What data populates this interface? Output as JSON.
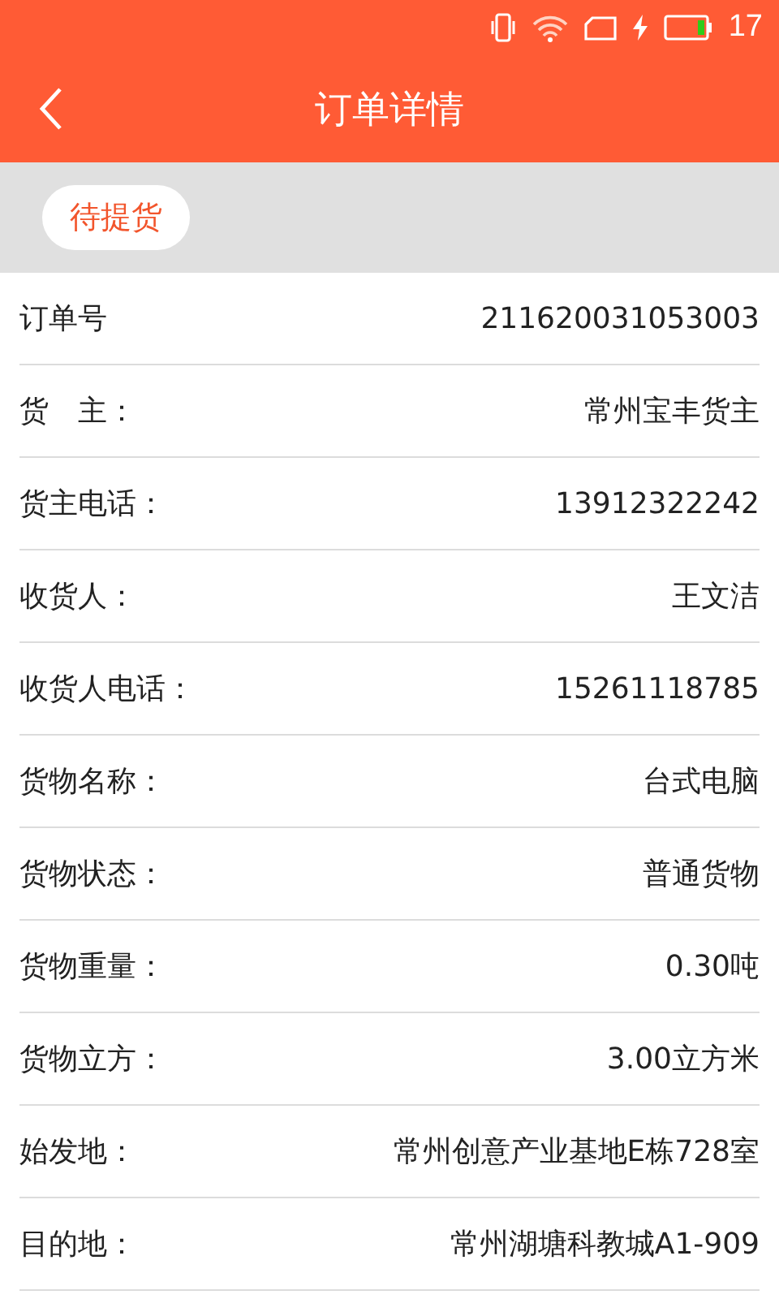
{
  "status_bar": {
    "time": "17"
  },
  "header": {
    "title": "订单详情"
  },
  "status_badge": "待提货",
  "fields": [
    {
      "label": "订单号",
      "value": "211620031053003"
    },
    {
      "label": "货　主：",
      "value": "常州宝丰货主"
    },
    {
      "label": "货主电话：",
      "value": "13912322242"
    },
    {
      "label": "收货人：",
      "value": "王文洁"
    },
    {
      "label": "收货人电话：",
      "value": "15261118785"
    },
    {
      "label": "货物名称：",
      "value": "台式电脑"
    },
    {
      "label": "货物状态：",
      "value": "普通货物"
    },
    {
      "label": "货物重量：",
      "value": "0.30吨"
    },
    {
      "label": "货物立方：",
      "value": "3.00立方米"
    },
    {
      "label": "始发地：",
      "value": "常州创意产业基地E栋728室"
    },
    {
      "label": "目的地：",
      "value": "常州湖塘科教城A1-909"
    }
  ]
}
